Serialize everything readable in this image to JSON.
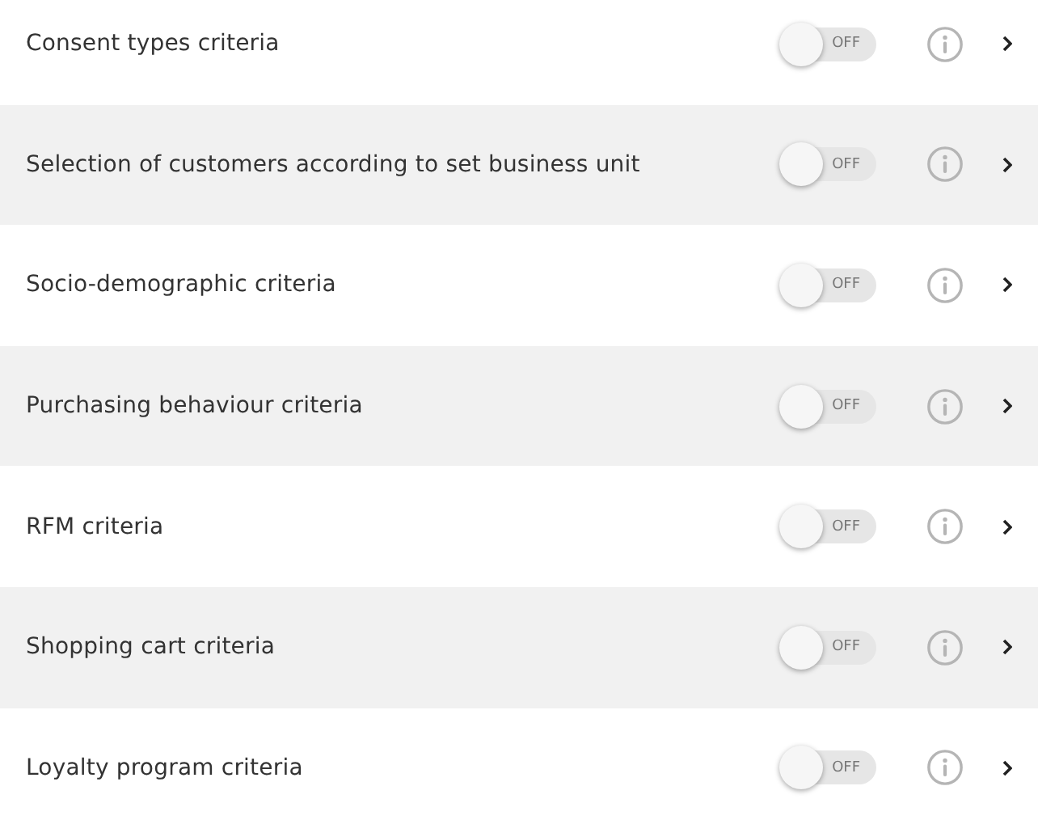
{
  "criteria": [
    {
      "label": "Consent types criteria",
      "on": false,
      "switch_text": "OFF"
    },
    {
      "label": "Selection of customers according to set business unit",
      "on": false,
      "switch_text": "OFF"
    },
    {
      "label": "Socio-demographic criteria",
      "on": false,
      "switch_text": "OFF"
    },
    {
      "label": "Purchasing behaviour criteria",
      "on": false,
      "switch_text": "OFF"
    },
    {
      "label": "RFM criteria",
      "on": false,
      "switch_text": "OFF"
    },
    {
      "label": "Shopping cart criteria",
      "on": false,
      "switch_text": "OFF"
    },
    {
      "label": "Loyalty program criteria",
      "on": false,
      "switch_text": "OFF"
    }
  ]
}
